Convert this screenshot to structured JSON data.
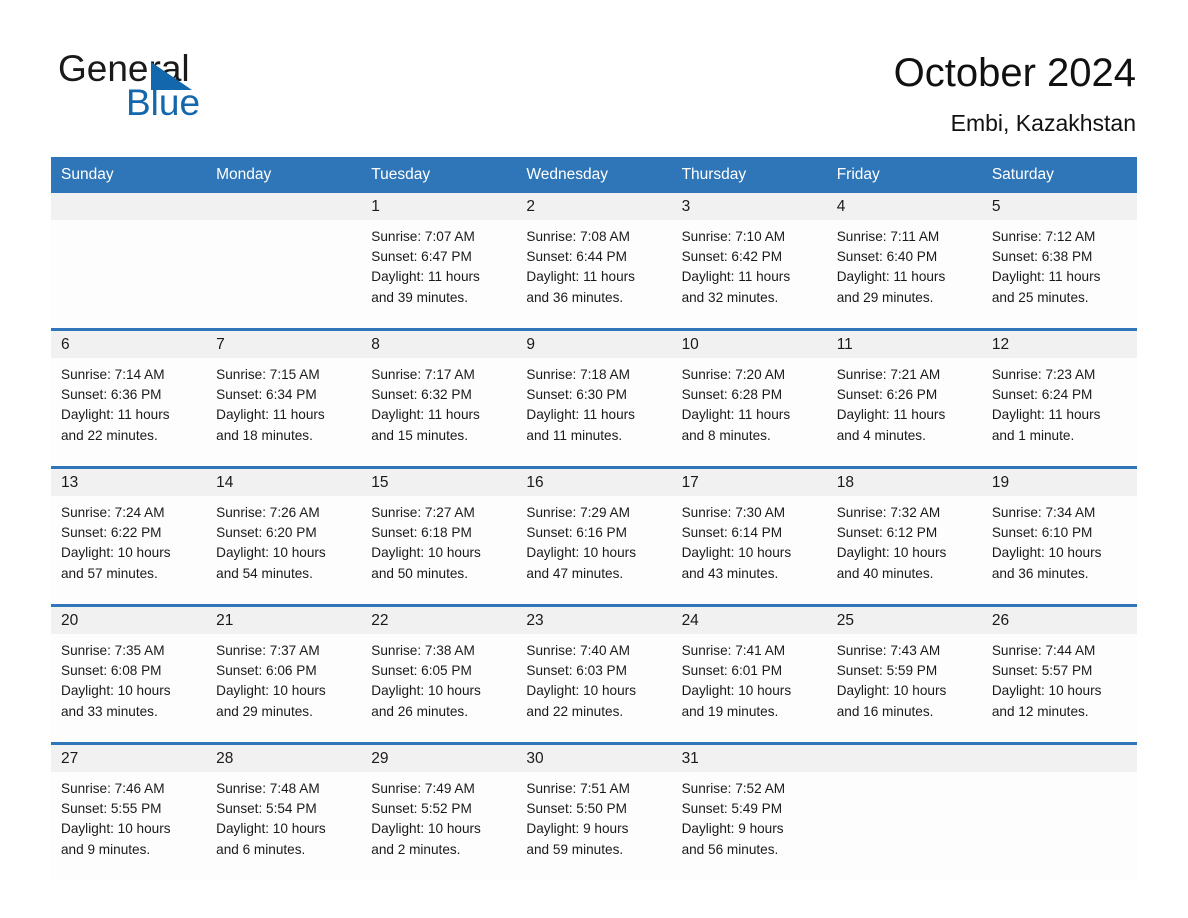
{
  "brand": {
    "name_primary": "General",
    "name_secondary": "Blue",
    "accent_color": "#1267ad"
  },
  "header": {
    "title": "October 2024",
    "location": "Embi, Kazakhstan",
    "header_bg": "#2f76b8",
    "header_text_color": "#ffffff",
    "daynum_bg": "#f1f1f1"
  },
  "weekday_headers": [
    "Sunday",
    "Monday",
    "Tuesday",
    "Wednesday",
    "Thursday",
    "Friday",
    "Saturday"
  ],
  "weeks": [
    [
      {
        "day": "",
        "empty": true
      },
      {
        "day": "",
        "empty": true
      },
      {
        "day": "1",
        "sunrise": "Sunrise: 7:07 AM",
        "sunset": "Sunset: 6:47 PM",
        "daylight_line1": "Daylight: 11 hours",
        "daylight_line2": "and 39 minutes."
      },
      {
        "day": "2",
        "sunrise": "Sunrise: 7:08 AM",
        "sunset": "Sunset: 6:44 PM",
        "daylight_line1": "Daylight: 11 hours",
        "daylight_line2": "and 36 minutes."
      },
      {
        "day": "3",
        "sunrise": "Sunrise: 7:10 AM",
        "sunset": "Sunset: 6:42 PM",
        "daylight_line1": "Daylight: 11 hours",
        "daylight_line2": "and 32 minutes."
      },
      {
        "day": "4",
        "sunrise": "Sunrise: 7:11 AM",
        "sunset": "Sunset: 6:40 PM",
        "daylight_line1": "Daylight: 11 hours",
        "daylight_line2": "and 29 minutes."
      },
      {
        "day": "5",
        "sunrise": "Sunrise: 7:12 AM",
        "sunset": "Sunset: 6:38 PM",
        "daylight_line1": "Daylight: 11 hours",
        "daylight_line2": "and 25 minutes."
      }
    ],
    [
      {
        "day": "6",
        "sunrise": "Sunrise: 7:14 AM",
        "sunset": "Sunset: 6:36 PM",
        "daylight_line1": "Daylight: 11 hours",
        "daylight_line2": "and 22 minutes."
      },
      {
        "day": "7",
        "sunrise": "Sunrise: 7:15 AM",
        "sunset": "Sunset: 6:34 PM",
        "daylight_line1": "Daylight: 11 hours",
        "daylight_line2": "and 18 minutes."
      },
      {
        "day": "8",
        "sunrise": "Sunrise: 7:17 AM",
        "sunset": "Sunset: 6:32 PM",
        "daylight_line1": "Daylight: 11 hours",
        "daylight_line2": "and 15 minutes."
      },
      {
        "day": "9",
        "sunrise": "Sunrise: 7:18 AM",
        "sunset": "Sunset: 6:30 PM",
        "daylight_line1": "Daylight: 11 hours",
        "daylight_line2": "and 11 minutes."
      },
      {
        "day": "10",
        "sunrise": "Sunrise: 7:20 AM",
        "sunset": "Sunset: 6:28 PM",
        "daylight_line1": "Daylight: 11 hours",
        "daylight_line2": "and 8 minutes."
      },
      {
        "day": "11",
        "sunrise": "Sunrise: 7:21 AM",
        "sunset": "Sunset: 6:26 PM",
        "daylight_line1": "Daylight: 11 hours",
        "daylight_line2": "and 4 minutes."
      },
      {
        "day": "12",
        "sunrise": "Sunrise: 7:23 AM",
        "sunset": "Sunset: 6:24 PM",
        "daylight_line1": "Daylight: 11 hours",
        "daylight_line2": "and 1 minute."
      }
    ],
    [
      {
        "day": "13",
        "sunrise": "Sunrise: 7:24 AM",
        "sunset": "Sunset: 6:22 PM",
        "daylight_line1": "Daylight: 10 hours",
        "daylight_line2": "and 57 minutes."
      },
      {
        "day": "14",
        "sunrise": "Sunrise: 7:26 AM",
        "sunset": "Sunset: 6:20 PM",
        "daylight_line1": "Daylight: 10 hours",
        "daylight_line2": "and 54 minutes."
      },
      {
        "day": "15",
        "sunrise": "Sunrise: 7:27 AM",
        "sunset": "Sunset: 6:18 PM",
        "daylight_line1": "Daylight: 10 hours",
        "daylight_line2": "and 50 minutes."
      },
      {
        "day": "16",
        "sunrise": "Sunrise: 7:29 AM",
        "sunset": "Sunset: 6:16 PM",
        "daylight_line1": "Daylight: 10 hours",
        "daylight_line2": "and 47 minutes."
      },
      {
        "day": "17",
        "sunrise": "Sunrise: 7:30 AM",
        "sunset": "Sunset: 6:14 PM",
        "daylight_line1": "Daylight: 10 hours",
        "daylight_line2": "and 43 minutes."
      },
      {
        "day": "18",
        "sunrise": "Sunrise: 7:32 AM",
        "sunset": "Sunset: 6:12 PM",
        "daylight_line1": "Daylight: 10 hours",
        "daylight_line2": "and 40 minutes."
      },
      {
        "day": "19",
        "sunrise": "Sunrise: 7:34 AM",
        "sunset": "Sunset: 6:10 PM",
        "daylight_line1": "Daylight: 10 hours",
        "daylight_line2": "and 36 minutes."
      }
    ],
    [
      {
        "day": "20",
        "sunrise": "Sunrise: 7:35 AM",
        "sunset": "Sunset: 6:08 PM",
        "daylight_line1": "Daylight: 10 hours",
        "daylight_line2": "and 33 minutes."
      },
      {
        "day": "21",
        "sunrise": "Sunrise: 7:37 AM",
        "sunset": "Sunset: 6:06 PM",
        "daylight_line1": "Daylight: 10 hours",
        "daylight_line2": "and 29 minutes."
      },
      {
        "day": "22",
        "sunrise": "Sunrise: 7:38 AM",
        "sunset": "Sunset: 6:05 PM",
        "daylight_line1": "Daylight: 10 hours",
        "daylight_line2": "and 26 minutes."
      },
      {
        "day": "23",
        "sunrise": "Sunrise: 7:40 AM",
        "sunset": "Sunset: 6:03 PM",
        "daylight_line1": "Daylight: 10 hours",
        "daylight_line2": "and 22 minutes."
      },
      {
        "day": "24",
        "sunrise": "Sunrise: 7:41 AM",
        "sunset": "Sunset: 6:01 PM",
        "daylight_line1": "Daylight: 10 hours",
        "daylight_line2": "and 19 minutes."
      },
      {
        "day": "25",
        "sunrise": "Sunrise: 7:43 AM",
        "sunset": "Sunset: 5:59 PM",
        "daylight_line1": "Daylight: 10 hours",
        "daylight_line2": "and 16 minutes."
      },
      {
        "day": "26",
        "sunrise": "Sunrise: 7:44 AM",
        "sunset": "Sunset: 5:57 PM",
        "daylight_line1": "Daylight: 10 hours",
        "daylight_line2": "and 12 minutes."
      }
    ],
    [
      {
        "day": "27",
        "sunrise": "Sunrise: 7:46 AM",
        "sunset": "Sunset: 5:55 PM",
        "daylight_line1": "Daylight: 10 hours",
        "daylight_line2": "and 9 minutes."
      },
      {
        "day": "28",
        "sunrise": "Sunrise: 7:48 AM",
        "sunset": "Sunset: 5:54 PM",
        "daylight_line1": "Daylight: 10 hours",
        "daylight_line2": "and 6 minutes."
      },
      {
        "day": "29",
        "sunrise": "Sunrise: 7:49 AM",
        "sunset": "Sunset: 5:52 PM",
        "daylight_line1": "Daylight: 10 hours",
        "daylight_line2": "and 2 minutes."
      },
      {
        "day": "30",
        "sunrise": "Sunrise: 7:51 AM",
        "sunset": "Sunset: 5:50 PM",
        "daylight_line1": "Daylight: 9 hours",
        "daylight_line2": "and 59 minutes."
      },
      {
        "day": "31",
        "sunrise": "Sunrise: 7:52 AM",
        "sunset": "Sunset: 5:49 PM",
        "daylight_line1": "Daylight: 9 hours",
        "daylight_line2": "and 56 minutes."
      },
      {
        "day": "",
        "empty": true
      },
      {
        "day": "",
        "empty": true
      }
    ]
  ]
}
